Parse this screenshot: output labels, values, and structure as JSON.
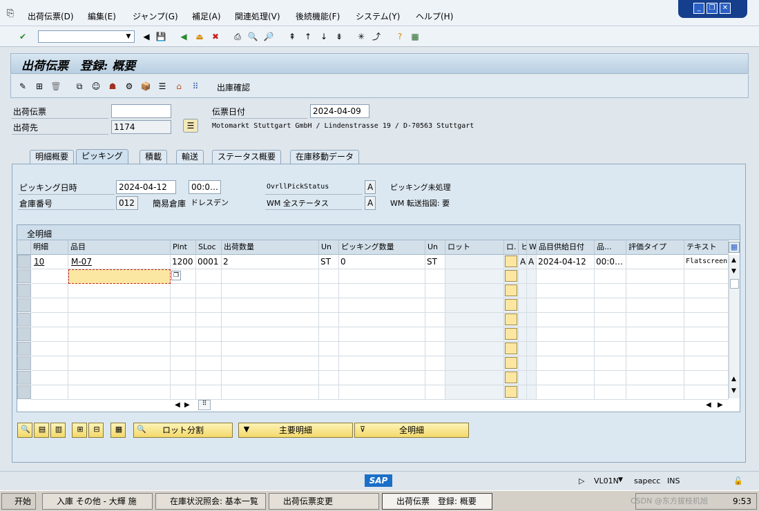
{
  "menu": {
    "items": [
      "出荷伝票(D)",
      "編集(E)",
      "ジャンプ(G)",
      "補足(A)",
      "関連処理(V)",
      "後続機能(F)",
      "システム(Y)",
      "ヘルプ(H)"
    ]
  },
  "toolbar": {
    "command_value": ""
  },
  "title": "出荷伝票　登録: 概要",
  "apptoolbar": {
    "goods_issue_label": "出庫確認"
  },
  "header": {
    "delivery_label": "出荷伝票",
    "delivery_value": "",
    "shipto_label": "出荷先",
    "shipto_value": "1174",
    "docdate_label": "伝票日付",
    "docdate_value": "2024-04-09",
    "address": "Motomarkt Stuttgart GmbH / Lindenstrasse 19 / D-70563 Stuttgart"
  },
  "tabs": [
    "明細概要",
    "ピッキング",
    "積載",
    "輸送",
    "ステータス概要",
    "在庫移動データ"
  ],
  "picking": {
    "date_label": "ピッキング日時",
    "date_value": "2024-04-12",
    "time_value": "00:0…",
    "whse_label": "倉庫番号",
    "whse_value": "012",
    "whse_type_label": "簡易倉庫",
    "whse_name": "ドレスデン",
    "ovrl_label": "OvrllPickStatus",
    "ovrl_value": "A",
    "ovrl_text": "ピッキング未処理",
    "wm_label": "WM 全ステータス",
    "wm_value": "A",
    "wm_text": "WM 転送指図: 要"
  },
  "table": {
    "title": "全明細",
    "columns": [
      "明細",
      "品目",
      "Plnt",
      "SLoc",
      "出荷数量",
      "Un",
      "ピッキング数量",
      "Un",
      "ロット",
      "ロ.",
      "ヒ",
      "W.",
      "品目供給日付",
      "品...",
      "評価タイプ",
      "テキスト"
    ],
    "rows": [
      [
        "10",
        "M-07",
        "1200",
        "0001",
        "2",
        "ST",
        "0",
        "ST",
        "",
        "",
        "A",
        "A",
        "2024-04-12",
        "00:0…",
        "",
        "Flatscreen"
      ]
    ]
  },
  "buttons": {
    "batch_split": "ロット分割",
    "main_items": "主要明細",
    "all_items": "全明細"
  },
  "status": {
    "tcode": "VL01N",
    "system": "sapecc",
    "mode": "INS"
  },
  "taskbar": {
    "start": "开始",
    "tasks": [
      "入庫 その他 - 大輝 施",
      "在庫状況照会: 基本一覧",
      "出荷伝票変更",
      "出荷伝票　登録: 概要"
    ],
    "clock": "9:53",
    "watermark": "CSDN @东方拔枝机旭"
  },
  "colors": {
    "accent": "#153e8c",
    "input_yellow": "#fbe7a2"
  }
}
